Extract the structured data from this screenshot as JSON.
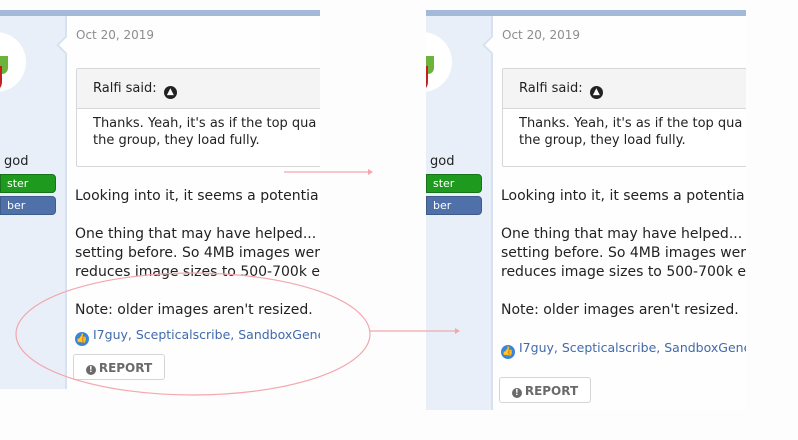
{
  "posts": {
    "date": "Oct 20, 2019",
    "sidebar": {
      "user_title": "god",
      "badge_green": "ster",
      "badge_blue": "ber"
    },
    "quote": {
      "author": "Ralfi said:",
      "line1": "Thanks. Yeah, it's as if the top qua",
      "line2": "the group, they load fully."
    },
    "body": {
      "line1": "Looking into it, it seems a potentia",
      "line2": "One thing that may have helped...",
      "line3": "setting before. So 4MB images wer",
      "line4": "reduces image sizes to 500-700k e",
      "note": "Note: older images aren't resized."
    },
    "likes": {
      "users": [
        "I7guy",
        "Scepticalscribe",
        "SandboxGene"
      ],
      "separator": ", "
    },
    "report_label": "REPORT"
  },
  "likes_text": "I7guy, Scepticalscribe, SandboxGene",
  "annotation_colors": {
    "ellipse": "#f4a6ad",
    "arrow": "#f4a6ad"
  }
}
